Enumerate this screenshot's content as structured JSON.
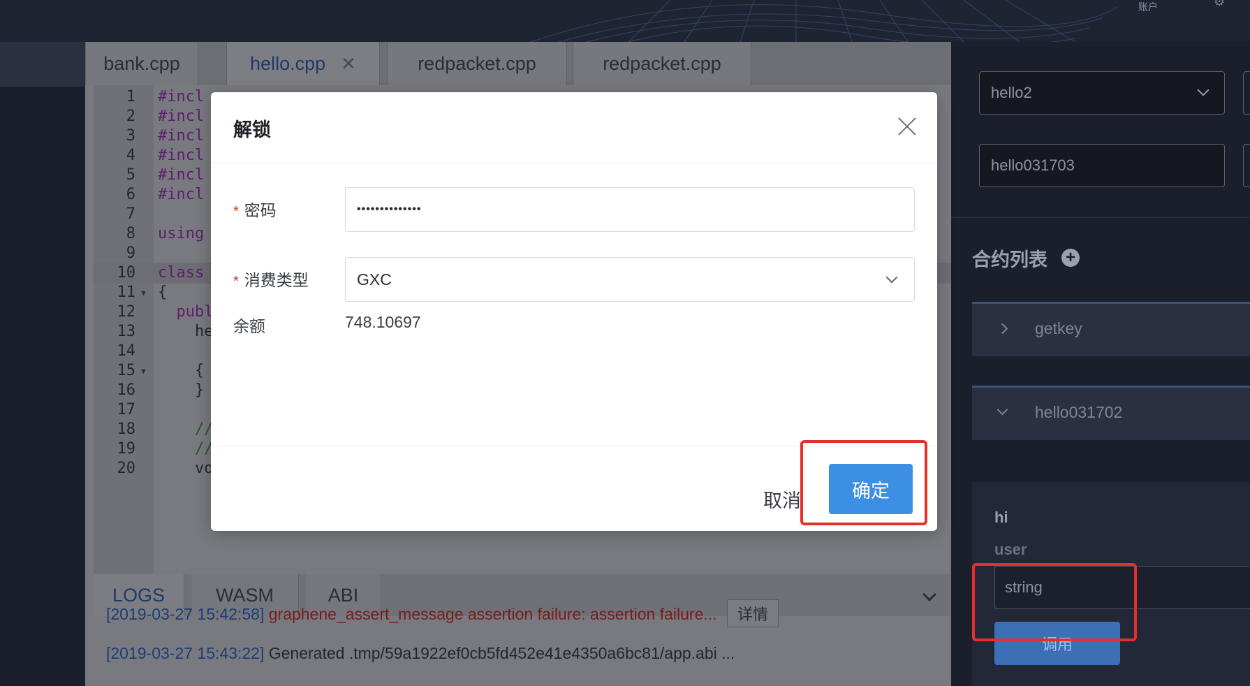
{
  "header": {
    "account_text": "账户"
  },
  "editor": {
    "tabs": [
      {
        "label": "bank.cpp"
      },
      {
        "label": "hello.cpp"
      },
      {
        "label": "redpacket.cpp"
      },
      {
        "label": "redpacket.cpp"
      }
    ],
    "line_numbers": [
      "1",
      "2",
      "3",
      "4",
      "5",
      "6",
      "7",
      "8",
      "9",
      "10",
      "11",
      "12",
      "13",
      "14",
      "15",
      "16",
      "17",
      "18",
      "19",
      "20"
    ],
    "code_lines": [
      "#incl",
      "#incl",
      "#incl",
      "#incl",
      "#incl",
      "#incl",
      "",
      "using",
      "",
      "class",
      "{",
      "  publ",
      "    he",
      "",
      "    {",
      "    }",
      "",
      "    //",
      "    //",
      "    vo"
    ],
    "bottom_tabs": [
      {
        "label": "LOGS"
      },
      {
        "label": "WASM"
      },
      {
        "label": "ABI"
      }
    ],
    "logs": [
      {
        "ts": "[2019-03-27 15:42:58]",
        "msg": "graphene_assert_message assertion failure: assertion failure...",
        "action": "详情"
      },
      {
        "ts": "[2019-03-27 15:43:22]",
        "msg": "Generated .tmp/59a1922ef0cb5fd452e41e4350a6bc81/app.abi ..."
      }
    ]
  },
  "sidebar": {
    "account_select": "hello2",
    "contract_input": "hello031703",
    "contract_list_title": "合约列表",
    "contracts": [
      {
        "label": "getkey"
      },
      {
        "label": "hello031702"
      }
    ],
    "method": {
      "name": "hi",
      "param_name": "user",
      "param_placeholder": "string",
      "invoke_label": "调用"
    }
  },
  "modal": {
    "title": "解锁",
    "password_label": "密码",
    "password_value": "••••••••••••••",
    "fee_type_label": "消费类型",
    "fee_type_value": "GXC",
    "balance_label": "余额",
    "balance_value": "748.10697",
    "cancel_label": "取消",
    "ok_label": "确定"
  },
  "colors": {
    "accent": "#3d8fe6",
    "annotation_red": "#e5302a",
    "error_text": "#7a1b1b"
  }
}
